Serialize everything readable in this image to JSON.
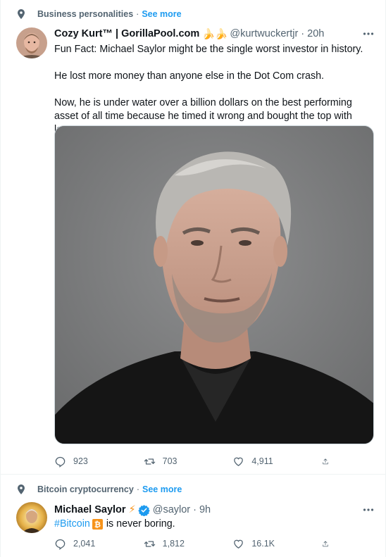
{
  "colors": {
    "accent": "#1d9bf0",
    "secondary_text": "#536471",
    "primary_text": "#0f1419",
    "border": "#eff3f4"
  },
  "tweets": [
    {
      "context": {
        "topic": "Business personalities",
        "separator": "·",
        "see_more": "See more"
      },
      "author": {
        "name": "Cozy Kurt™ | GorillaPool.com",
        "emoji": "🍌🍌",
        "handle": "@kurtwuckertjr",
        "time": "20h"
      },
      "more_icon": "more-horizontal-icon",
      "text": [
        "Fun Fact: Michael Saylor might be the single worst investor in history.",
        "He lost more money than anyone else in the Dot Com crash.",
        "Now, he is under water over a billion dollars on the best performing asset of all time because he timed it wrong and bought the top with leverage."
      ],
      "media": "portrait-photo",
      "stats": {
        "replies": "923",
        "retweets": "703",
        "likes": "4,911"
      }
    },
    {
      "context": {
        "topic": "Bitcoin cryptocurrency",
        "separator": "·",
        "see_more": "See more"
      },
      "author": {
        "name": "Michael Saylor",
        "emoji": "⚡",
        "verified": true,
        "handle": "@saylor",
        "time": "9h"
      },
      "more_icon": "more-horizontal-icon",
      "text": {
        "hashtag": "#Bitcoin",
        "rest": "is never boring."
      },
      "stats": {
        "replies": "2,041",
        "retweets": "1,812",
        "likes": "16.1K"
      }
    }
  ]
}
